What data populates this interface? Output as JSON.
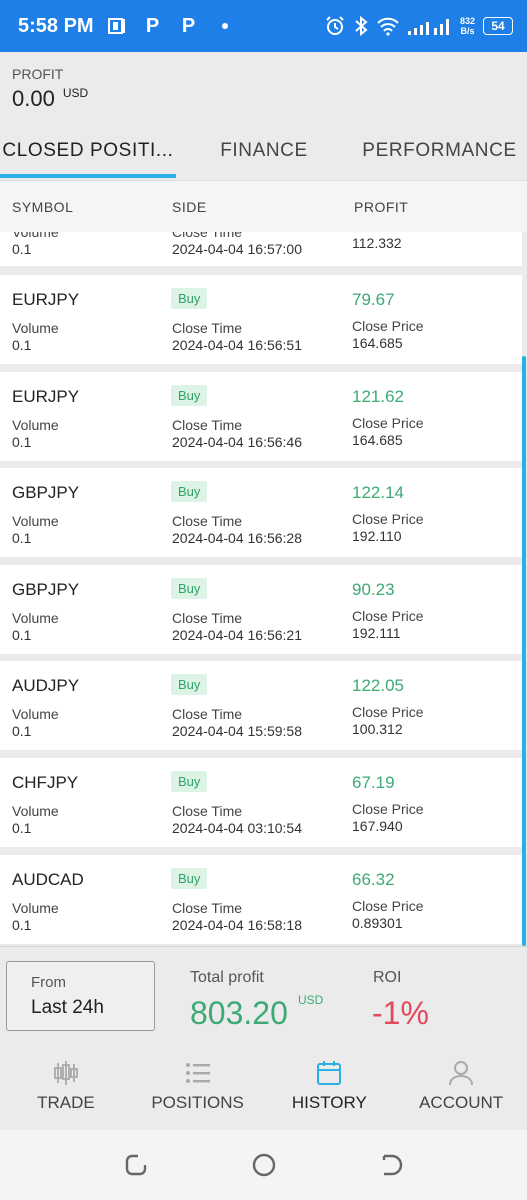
{
  "status_bar": {
    "time": "5:58 PM",
    "app_icons": [
      "P",
      "P"
    ],
    "speed_value": "832",
    "speed_unit": "B/s",
    "battery": "54"
  },
  "profit_header": {
    "label": "PROFIT",
    "value": "0.00",
    "currency": "USD"
  },
  "tabs": [
    {
      "label": "CLOSED POSITI..."
    },
    {
      "label": "FINANCE"
    },
    {
      "label": "PERFORMANCE"
    }
  ],
  "columns": {
    "symbol": "SYMBOL",
    "side": "SIDE",
    "profit": "PROFIT"
  },
  "labels": {
    "volume": "Volume",
    "close_time": "Close Time",
    "close_price": "Close Price"
  },
  "partial_row": {
    "volume": "0.1",
    "close_time": "2024-04-04 16:57:00",
    "close_price": "112.332"
  },
  "positions": [
    {
      "symbol": "EURJPY",
      "side": "Buy",
      "profit": "79.67",
      "volume": "0.1",
      "close_time": "2024-04-04 16:56:51",
      "close_price": "164.685"
    },
    {
      "symbol": "EURJPY",
      "side": "Buy",
      "profit": "121.62",
      "volume": "0.1",
      "close_time": "2024-04-04 16:56:46",
      "close_price": "164.685"
    },
    {
      "symbol": "GBPJPY",
      "side": "Buy",
      "profit": "122.14",
      "volume": "0.1",
      "close_time": "2024-04-04 16:56:28",
      "close_price": "192.110"
    },
    {
      "symbol": "GBPJPY",
      "side": "Buy",
      "profit": "90.23",
      "volume": "0.1",
      "close_time": "2024-04-04 16:56:21",
      "close_price": "192.111"
    },
    {
      "symbol": "AUDJPY",
      "side": "Buy",
      "profit": "122.05",
      "volume": "0.1",
      "close_time": "2024-04-04 15:59:58",
      "close_price": "100.312"
    },
    {
      "symbol": "CHFJPY",
      "side": "Buy",
      "profit": "67.19",
      "volume": "0.1",
      "close_time": "2024-04-04 03:10:54",
      "close_price": "167.940"
    },
    {
      "symbol": "AUDCAD",
      "side": "Buy",
      "profit": "66.32",
      "volume": "0.1",
      "close_time": "2024-04-04 16:58:18",
      "close_price": "0.89301"
    }
  ],
  "summary": {
    "from_label": "From",
    "from_value": "Last 24h",
    "total_label": "Total profit",
    "total_value": "803.20",
    "total_currency": "USD",
    "roi_label": "ROI",
    "roi_value": "-1%"
  },
  "bottom_nav": [
    {
      "label": "TRADE",
      "icon": "candlestick-icon"
    },
    {
      "label": "POSITIONS",
      "icon": "list-icon"
    },
    {
      "label": "HISTORY",
      "icon": "calendar-icon"
    },
    {
      "label": "ACCOUNT",
      "icon": "user-icon"
    }
  ],
  "colors": {
    "accent": "#1e7fe8",
    "tab_underline": "#29b1e6",
    "profit_green": "#3daa76",
    "roi_red": "#e04a5a"
  }
}
